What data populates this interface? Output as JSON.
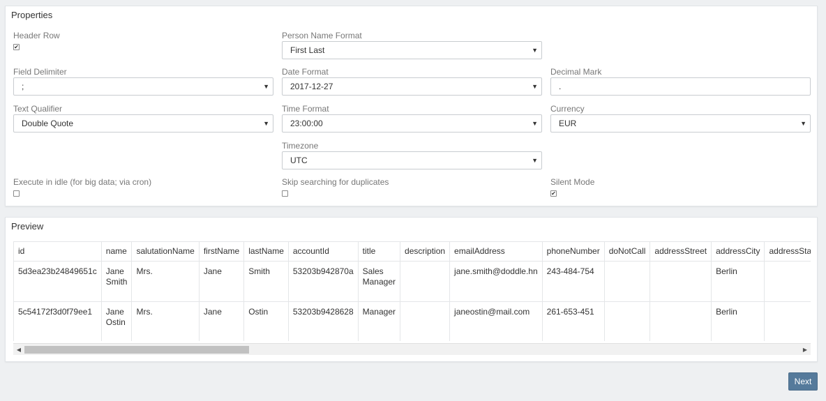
{
  "properties": {
    "title": "Properties",
    "header_row": {
      "label": "Header Row",
      "checked": true
    },
    "person_name_format": {
      "label": "Person Name Format",
      "value": "First Last"
    },
    "field_delimiter": {
      "label": "Field Delimiter",
      "value": ";"
    },
    "date_format": {
      "label": "Date Format",
      "value": "2017-12-27"
    },
    "decimal_mark": {
      "label": "Decimal Mark",
      "value": "."
    },
    "text_qualifier": {
      "label": "Text Qualifier",
      "value": "Double Quote"
    },
    "time_format": {
      "label": "Time Format",
      "value": "23:00:00"
    },
    "currency": {
      "label": "Currency",
      "value": "EUR"
    },
    "timezone": {
      "label": "Timezone",
      "value": "UTC"
    },
    "execute_idle": {
      "label": "Execute in idle (for big data; via cron)",
      "checked": false
    },
    "skip_duplicates": {
      "label": "Skip searching for duplicates",
      "checked": false
    },
    "silent_mode": {
      "label": "Silent Mode",
      "checked": true
    },
    "caret": "▼",
    "check_mark": "✔"
  },
  "preview": {
    "title": "Preview",
    "columns": [
      "id",
      "name",
      "salutationName",
      "firstName",
      "lastName",
      "accountId",
      "title",
      "description",
      "emailAddress",
      "phoneNumber",
      "doNotCall",
      "addressStreet",
      "addressCity",
      "addressSta"
    ],
    "rows": [
      [
        "5d3ea23b24849651c",
        "Jane Smith",
        "Mrs.",
        "Jane",
        "Smith",
        "53203b942870a",
        "Sales Manager",
        "",
        "jane.smith@doddle.hn",
        "243-484-754",
        "",
        "",
        "Berlin",
        ""
      ],
      [
        "5c54172f3d0f79ee1",
        "Jane Ostin",
        "Mrs.",
        "Jane",
        "Ostin",
        "53203b9428628",
        "Manager",
        "",
        "janeostin@mail.com",
        "261-653-451",
        "",
        "",
        "Berlin",
        ""
      ]
    ],
    "scroll_left_arrow": "◀",
    "scroll_right_arrow": "▶"
  },
  "footer": {
    "next_label": "Next"
  }
}
